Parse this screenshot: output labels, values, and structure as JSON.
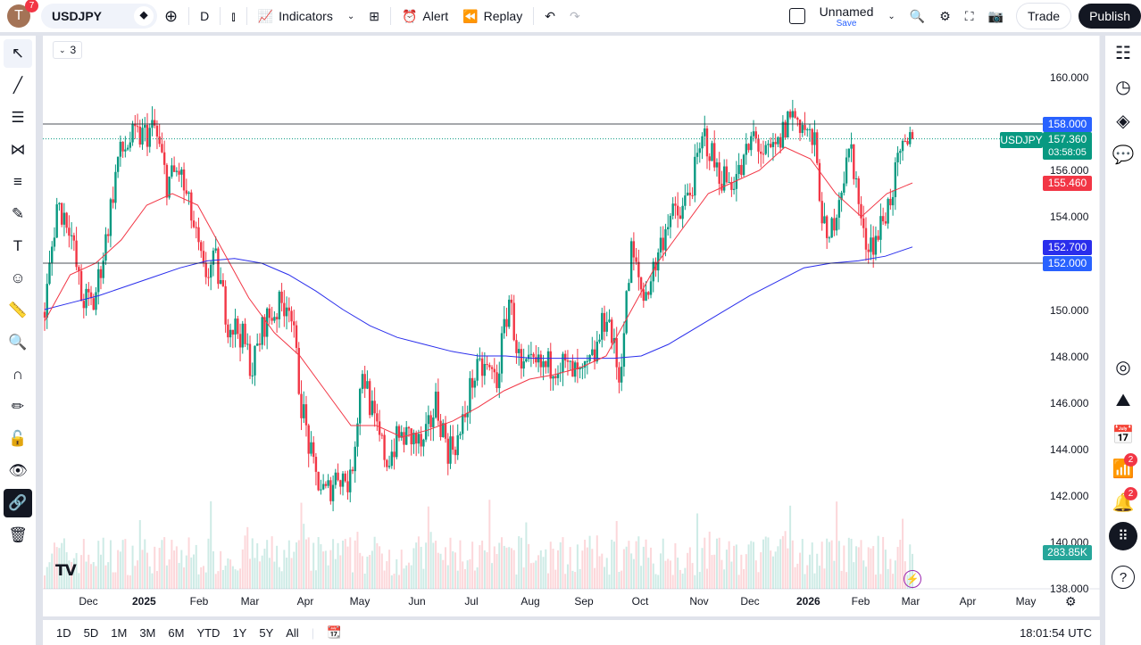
{
  "header": {
    "avatar_letter": "T",
    "avatar_badge": "7",
    "symbol": "USDJPY",
    "interval": "D",
    "indicators": "Indicators",
    "alert": "Alert",
    "replay": "Replay",
    "layout_name": "Unnamed",
    "save": "Save",
    "trade": "Trade",
    "publish": "Publish"
  },
  "chart": {
    "indicator_count": "3",
    "logo": "TV"
  },
  "price_axis": {
    "labels": [
      "160.000",
      "158.000",
      "156.000",
      "154.000",
      "152.000",
      "150.000",
      "148.000",
      "146.000",
      "144.000",
      "142.000",
      "140.000",
      "138.000"
    ],
    "tags": {
      "hline_top": "158.000",
      "symbol": "USDJPY",
      "last_price": "157.360",
      "countdown": "03:58:05",
      "ma_red": "155.460",
      "ma_blue": "152.700",
      "hline_bottom": "152.000",
      "volume": "283.85K"
    }
  },
  "time_axis": {
    "labels": [
      "Dec",
      "2025",
      "Feb",
      "Mar",
      "Apr",
      "May",
      "Jun",
      "Jul",
      "Aug",
      "Sep",
      "Oct",
      "Nov",
      "Dec",
      "2026",
      "Feb",
      "Mar",
      "Apr",
      "May"
    ]
  },
  "bottom_bar": {
    "ranges": [
      "1D",
      "5D",
      "1M",
      "3M",
      "6M",
      "YTD",
      "1Y",
      "5Y",
      "All"
    ],
    "clock": "18:01:54 UTC"
  },
  "right_bar": {
    "ideas_badge": "2",
    "alerts_badge": "2"
  },
  "colors": {
    "up": "#089981",
    "down": "#f23645",
    "ma_fast": "#f23645",
    "ma_slow": "#2a2eec",
    "hline": "#2962ff"
  },
  "chart_data": {
    "type": "candlestick",
    "symbol": "USDJPY",
    "interval": "D",
    "ylim": [
      138,
      160.5
    ],
    "weekly_closes": [
      149.9,
      154.5,
      153.8,
      150.5,
      150.2,
      153,
      156.5,
      157.3,
      157.5,
      157.8,
      155.5,
      156,
      154,
      151.5,
      152,
      149.5,
      149,
      147.5,
      149.5,
      150,
      150.5,
      146,
      143,
      142,
      143,
      142.5,
      147.5,
      145,
      143.5,
      144.5,
      144.5,
      144,
      146,
      144,
      144.5,
      147,
      147.5,
      147,
      150.5,
      147.2,
      147.5,
      147.5,
      147.8,
      147.3,
      147,
      148,
      150,
      147,
      152.5,
      150.5,
      152,
      154,
      154,
      155.5,
      157.5,
      156,
      155.5,
      156,
      157.5,
      156.5,
      157,
      158.5,
      158,
      157,
      152.5,
      155,
      157,
      153,
      153,
      154.5,
      156.5,
      157.36
    ],
    "ma_fast_points": [
      149.5,
      151.5,
      152,
      153,
      154.5,
      155,
      154.5,
      152.5,
      150.5,
      149,
      148,
      146.5,
      145,
      145,
      144.5,
      144.8,
      145.2,
      145.8,
      146.5,
      147,
      147.2,
      147.5,
      148,
      150,
      152,
      153.5,
      155,
      155.5,
      156,
      157,
      156.5,
      155,
      154,
      155,
      155.46
    ],
    "ma_slow_points": [
      150,
      150.3,
      150.6,
      151,
      151.4,
      151.8,
      152.1,
      152.2,
      152,
      151.5,
      150.8,
      150,
      149.3,
      148.8,
      148.5,
      148.2,
      148,
      148,
      147.9,
      147.9,
      147.9,
      147.9,
      148,
      148.5,
      149.2,
      149.9,
      150.6,
      151.2,
      151.8,
      152,
      152.1,
      152.3,
      152.7
    ],
    "hlines": [
      158,
      152
    ]
  }
}
